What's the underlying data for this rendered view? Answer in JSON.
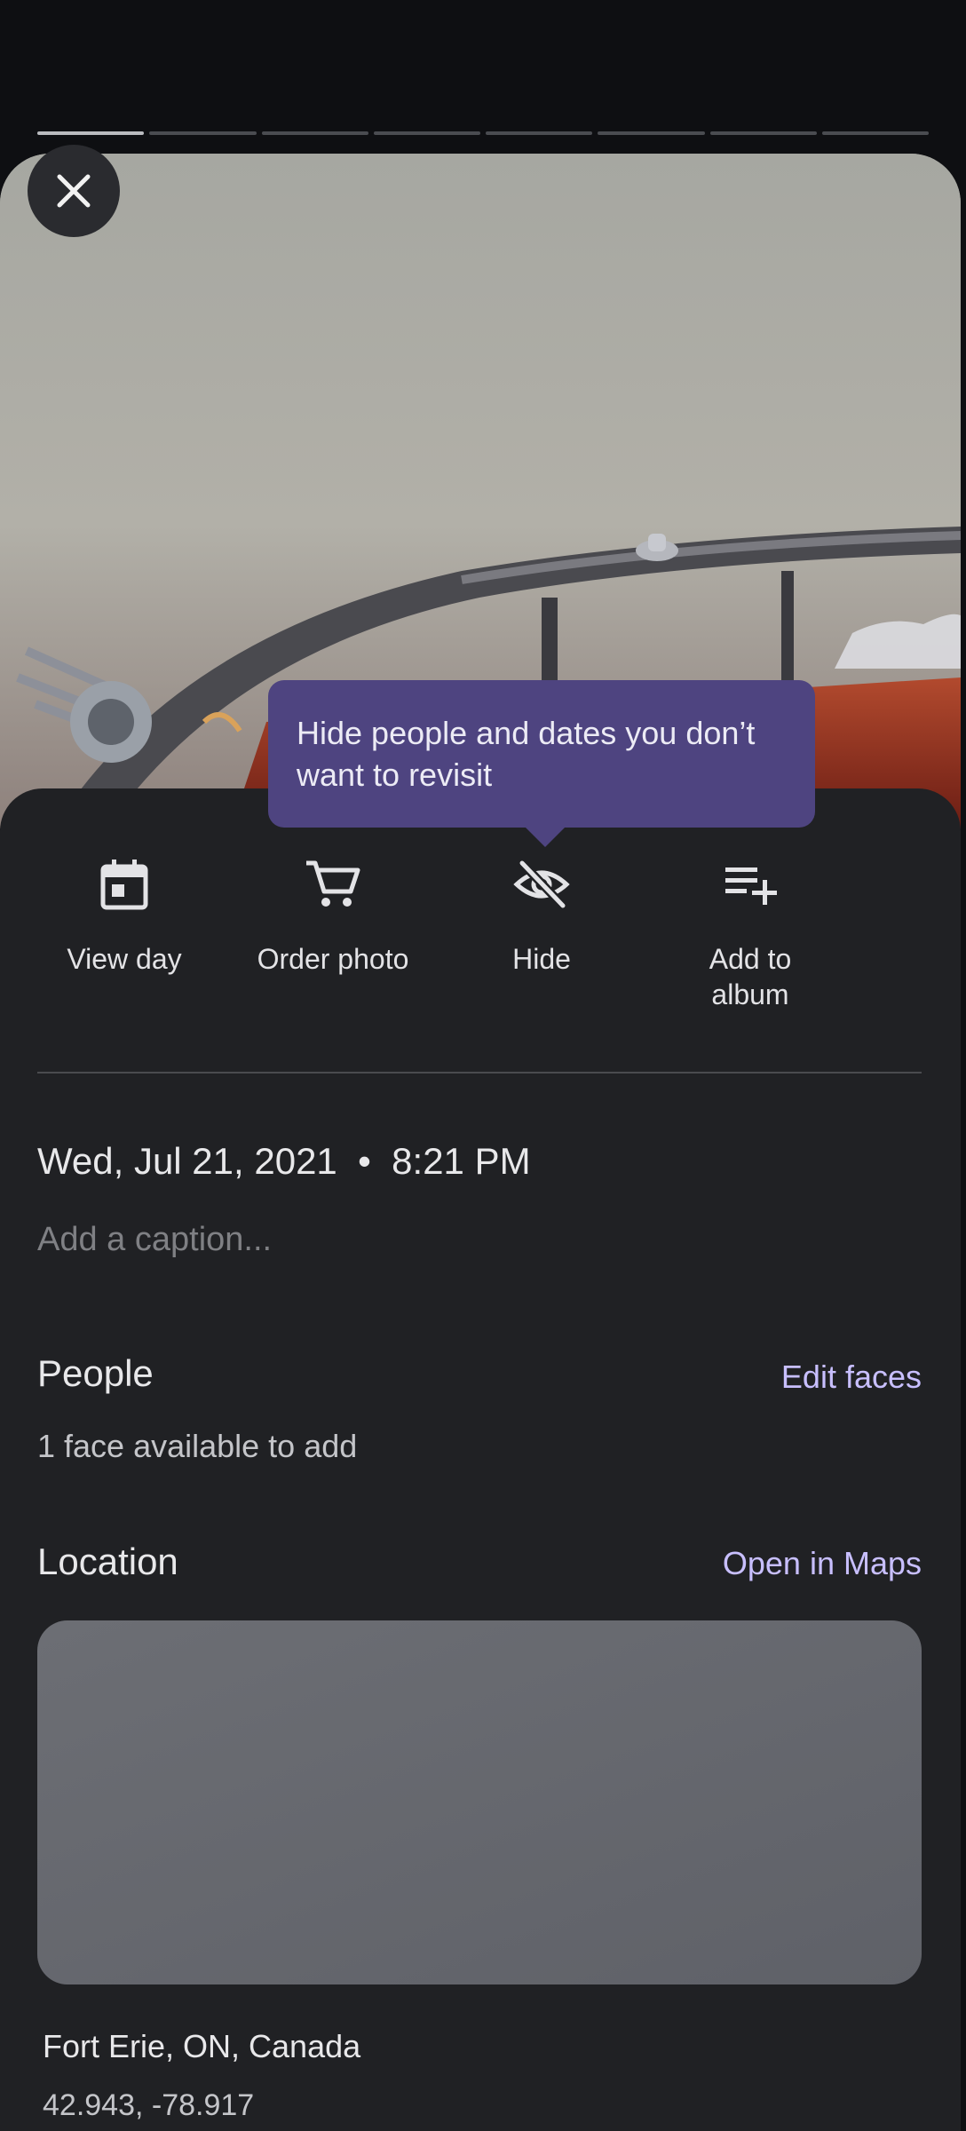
{
  "progress": {
    "total": 8,
    "active": 1
  },
  "tooltip": {
    "text": "Hide people and dates you don’t want to revisit"
  },
  "actions": [
    {
      "label": "View day",
      "icon": "calendar-icon"
    },
    {
      "label": "Order photo",
      "icon": "cart-icon"
    },
    {
      "label": "Hide",
      "icon": "eye-off-icon"
    },
    {
      "label": "Add to album",
      "icon": "playlist-add-icon"
    }
  ],
  "details": {
    "date": "Wed, Jul 21, 2021  •  8:21 PM",
    "caption_placeholder": "Add a caption..."
  },
  "people": {
    "title": "People",
    "action": "Edit faces",
    "subtitle": "1 face available to add"
  },
  "location": {
    "title": "Location",
    "action": "Open in Maps",
    "name": "Fort Erie, ON, Canada",
    "coordinates": "42.943, -78.917"
  },
  "colors": {
    "accent": "#c8bfff",
    "tooltip": "#4e4480",
    "sheet": "#202124"
  }
}
